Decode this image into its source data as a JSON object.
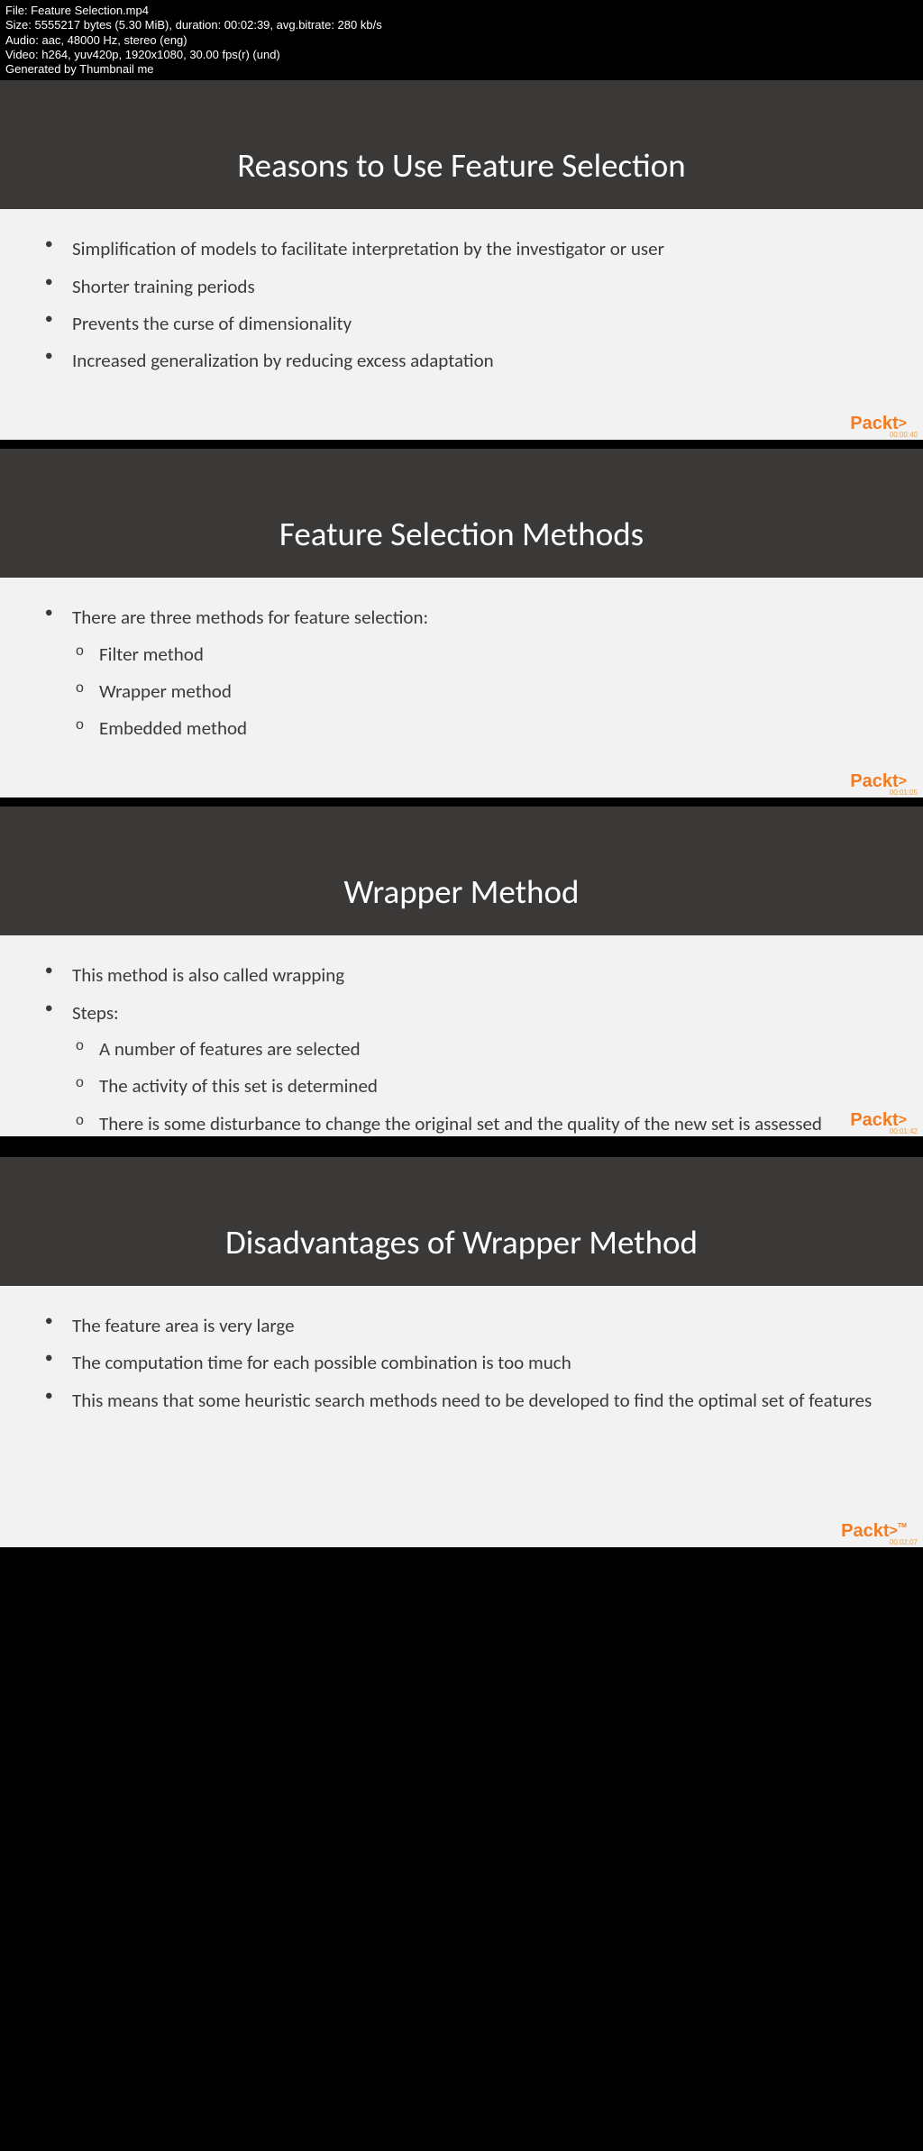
{
  "meta": {
    "line1": "File: Feature Selection.mp4",
    "line2": "Size: 5555217 bytes (5.30 MiB), duration: 00:02:39, avg.bitrate: 280 kb/s",
    "line3": "Audio: aac, 48000 Hz, stereo (eng)",
    "line4": "Video: h264, yuv420p, 1920x1080, 30.00 fps(r) (und)",
    "line5": "Generated by Thumbnail me"
  },
  "brand": "Packt",
  "slides": [
    {
      "title": "Reasons to Use Feature Selection",
      "timestamp": "00:00:40",
      "bullets": [
        {
          "text": "Simplification of models to facilitate interpretation by the investigator or user"
        },
        {
          "text": "Shorter training periods"
        },
        {
          "text": "Prevents the curse of dimensionality"
        },
        {
          "text": "Increased generalization by reducing excess adaptation"
        }
      ]
    },
    {
      "title": "Feature Selection Methods",
      "timestamp": "00:01:05",
      "bullets": [
        {
          "text": "There are three methods for feature selection:",
          "sub": [
            "Filter method",
            "Wrapper method",
            "Embedded method"
          ]
        }
      ]
    },
    {
      "title": "Wrapper Method",
      "timestamp": "00:01:42",
      "bullets": [
        {
          "text": "This method is also called wrapping"
        },
        {
          "text": "Steps:",
          "sub": [
            "A number of features are selected",
            "The activity of this set is determined",
            "There is some disturbance to change the original set and the quality of the new set is assessed"
          ]
        }
      ]
    },
    {
      "title": "Disadvantages of Wrapper Method",
      "timestamp": "00:02:07",
      "bullets": [
        {
          "text": "The feature area is very large"
        },
        {
          "text": "The computation time for each possible combination is too much"
        },
        {
          "text": "This means that some heuristic search methods need to be developed to find the optimal set of features"
        }
      ]
    }
  ]
}
